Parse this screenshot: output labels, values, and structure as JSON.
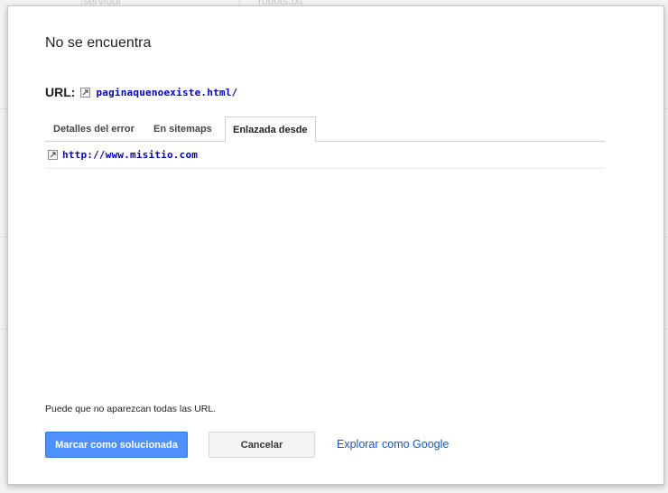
{
  "background": {
    "cells": [
      "servidor",
      "robots.txt"
    ]
  },
  "dialog": {
    "title": "No se encuentra",
    "url_label": "URL:",
    "url_value": "paginaquenoexiste.html/",
    "tabs": [
      {
        "label": "Detalles del error",
        "active": false
      },
      {
        "label": "En sitemaps",
        "active": false
      },
      {
        "label": "Enlazada desde",
        "active": true
      }
    ],
    "linked_from": [
      {
        "url": "http://www.misitio.com",
        "icon": "external-link-icon"
      }
    ],
    "note": "Puede que no aparezcan todas las URL.",
    "buttons": {
      "mark_fixed": "Marcar como solucionada",
      "cancel": "Cancelar"
    },
    "explore_link": "Explorar como Google"
  },
  "colors": {
    "primary": "#4d90fe",
    "link": "#1155cc",
    "url_link": "#0000cc"
  }
}
